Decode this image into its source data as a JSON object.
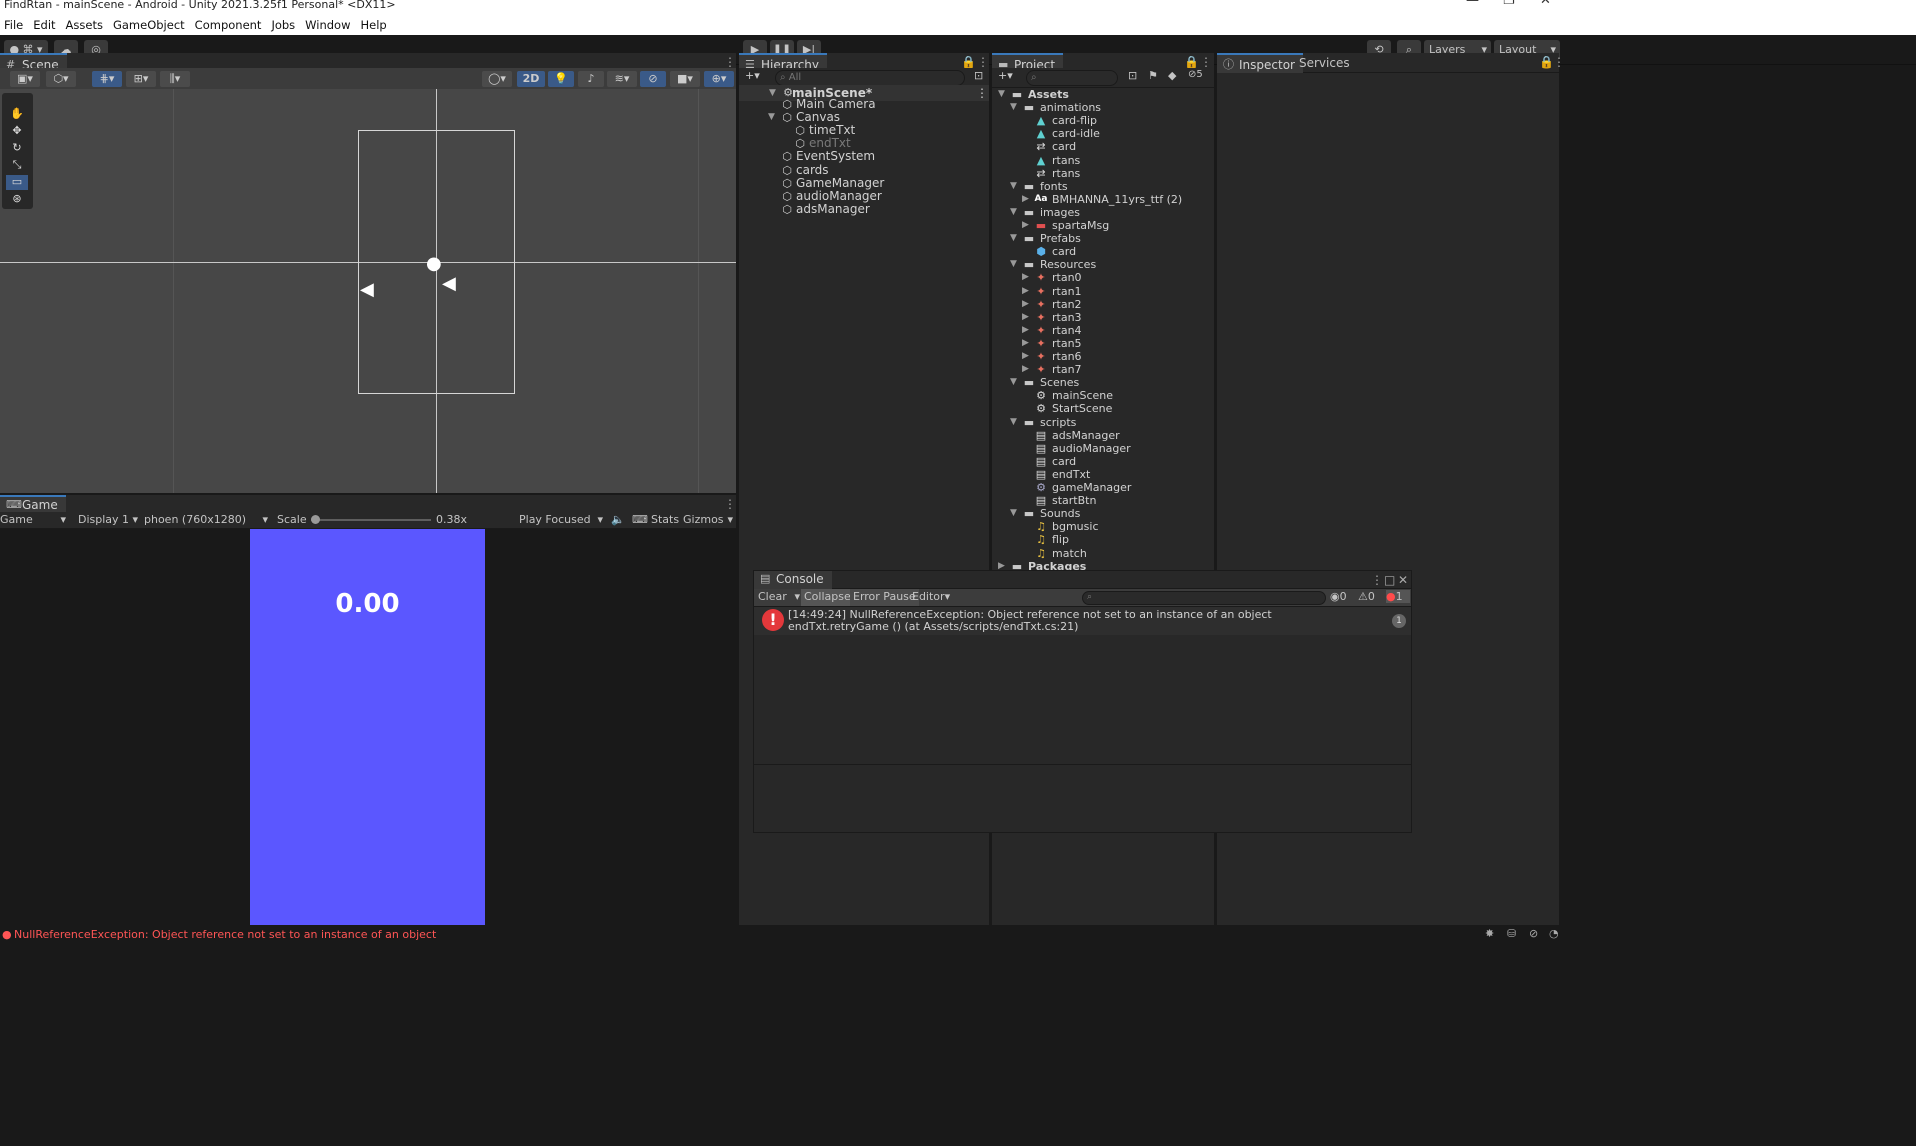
{
  "window": {
    "title": "FindRtan - mainScene - Android - Unity 2021.3.25f1 Personal* <DX11>"
  },
  "menu": [
    "File",
    "Edit",
    "Assets",
    "GameObject",
    "Component",
    "Jobs",
    "Window",
    "Help"
  ],
  "toolbar": {
    "layers_label": "Layers",
    "layout_label": "Layout"
  },
  "scene": {
    "tab_label": "Scene",
    "mode_2d": "2D"
  },
  "game": {
    "tab_label": "Game",
    "view_select": "Game",
    "display_select": "Display 1",
    "resolution_select": "phoen (760x1280)",
    "scale_label": "Scale",
    "scale_value": "0.38x",
    "scale_fraction": 0.0,
    "play_focused": "Play Focused",
    "stats_label": "Stats",
    "gizmos_label": "Gizmos",
    "time_text": "0.00",
    "screen_color": "#5b57ff"
  },
  "hierarchy": {
    "tab_label": "Hierarchy",
    "search_placeholder": "All",
    "scene_name": "mainScene*",
    "items": [
      {
        "label": "Main Camera",
        "depth": 1
      },
      {
        "label": "Canvas",
        "depth": 1,
        "expanded": true
      },
      {
        "label": "timeTxt",
        "depth": 2
      },
      {
        "label": "endTxt",
        "depth": 2,
        "inactive": true
      },
      {
        "label": "EventSystem",
        "depth": 1
      },
      {
        "label": "cards",
        "depth": 1
      },
      {
        "label": "GameManager",
        "depth": 1
      },
      {
        "label": "audioManager",
        "depth": 1
      },
      {
        "label": "adsManager",
        "depth": 1
      }
    ]
  },
  "project": {
    "tab_label": "Project",
    "hidden_count": "5",
    "items": [
      {
        "label": "Assets",
        "depth": 0,
        "folder": true,
        "open": true,
        "bold": true
      },
      {
        "label": "animations",
        "depth": 1,
        "folder": true,
        "open": true
      },
      {
        "label": "card-flip",
        "depth": 2,
        "icon": "anim"
      },
      {
        "label": "card-idle",
        "depth": 2,
        "icon": "anim"
      },
      {
        "label": "card",
        "depth": 2,
        "icon": "ctrl"
      },
      {
        "label": "rtans",
        "depth": 2,
        "icon": "anim"
      },
      {
        "label": "rtans",
        "depth": 2,
        "icon": "ctrl"
      },
      {
        "label": "fonts",
        "depth": 1,
        "folder": true,
        "open": true
      },
      {
        "label": "BMHANNA_11yrs_ttf (2)",
        "depth": 2,
        "icon": "font",
        "collapsed": true
      },
      {
        "label": "images",
        "depth": 1,
        "folder": true,
        "open": true
      },
      {
        "label": "spartaMsg",
        "depth": 2,
        "icon": "img",
        "collapsed": true
      },
      {
        "label": "Prefabs",
        "depth": 1,
        "folder": true,
        "open": true
      },
      {
        "label": "card",
        "depth": 2,
        "icon": "prefab"
      },
      {
        "label": "Resources",
        "depth": 1,
        "folder": true,
        "open": true
      },
      {
        "label": "rtan0",
        "depth": 2,
        "icon": "sprite",
        "collapsed": true
      },
      {
        "label": "rtan1",
        "depth": 2,
        "icon": "sprite",
        "collapsed": true
      },
      {
        "label": "rtan2",
        "depth": 2,
        "icon": "sprite",
        "collapsed": true
      },
      {
        "label": "rtan3",
        "depth": 2,
        "icon": "sprite",
        "collapsed": true
      },
      {
        "label": "rtan4",
        "depth": 2,
        "icon": "sprite",
        "collapsed": true
      },
      {
        "label": "rtan5",
        "depth": 2,
        "icon": "sprite",
        "collapsed": true
      },
      {
        "label": "rtan6",
        "depth": 2,
        "icon": "sprite",
        "collapsed": true
      },
      {
        "label": "rtan7",
        "depth": 2,
        "icon": "sprite",
        "collapsed": true
      },
      {
        "label": "Scenes",
        "depth": 1,
        "folder": true,
        "open": true
      },
      {
        "label": "mainScene",
        "depth": 2,
        "icon": "scene"
      },
      {
        "label": "StartScene",
        "depth": 2,
        "icon": "scene"
      },
      {
        "label": "scripts",
        "depth": 1,
        "folder": true,
        "open": true
      },
      {
        "label": "adsManager",
        "depth": 2,
        "icon": "script"
      },
      {
        "label": "audioManager",
        "depth": 2,
        "icon": "script"
      },
      {
        "label": "card",
        "depth": 2,
        "icon": "script"
      },
      {
        "label": "endTxt",
        "depth": 2,
        "icon": "script"
      },
      {
        "label": "gameManager",
        "depth": 2,
        "icon": "gear"
      },
      {
        "label": "startBtn",
        "depth": 2,
        "icon": "script"
      },
      {
        "label": "Sounds",
        "depth": 1,
        "folder": true,
        "open": true
      },
      {
        "label": "bgmusic",
        "depth": 2,
        "icon": "audio"
      },
      {
        "label": "flip",
        "depth": 2,
        "icon": "audio"
      },
      {
        "label": "match",
        "depth": 2,
        "icon": "audio"
      },
      {
        "label": "Packages",
        "depth": 0,
        "folder": true,
        "open": false,
        "bold": true
      }
    ]
  },
  "inspector": {
    "tab_label": "Inspector",
    "services_label": "Services"
  },
  "console": {
    "tab_label": "Console",
    "clear_label": "Clear",
    "collapse_label": "Collapse",
    "error_pause_label": "Error Pause",
    "editor_label": "Editor",
    "log_count": "0",
    "warn_count": "0",
    "error_count": "1",
    "entry_line1": "[14:49:24] NullReferenceException: Object reference not set to an instance of an object",
    "entry_line2": "endTxt.retryGame () (at Assets/scripts/endTxt.cs:21)",
    "entry_count": "1"
  },
  "status": {
    "message": "NullReferenceException: Object reference not set to an instance of an object",
    "error_color": "#ff5555"
  }
}
